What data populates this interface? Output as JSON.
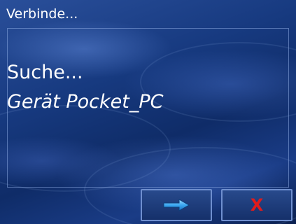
{
  "titlebar": {
    "title": "Verbinde..."
  },
  "content": {
    "status": "Suche...",
    "device": "Gerät Pocket_PC"
  },
  "buttons": {
    "next_icon": "arrow-right-icon",
    "cancel_label": "X"
  },
  "colors": {
    "background": "#173a80",
    "text": "#ffffff",
    "cancel": "#e01b1b",
    "arrow": "#4fb3ff"
  }
}
